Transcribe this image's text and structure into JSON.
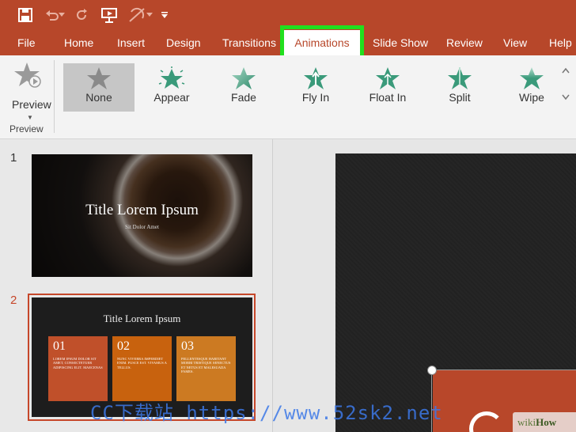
{
  "tabs": [
    {
      "label": "File"
    },
    {
      "label": "Home"
    },
    {
      "label": "Insert"
    },
    {
      "label": "Design"
    },
    {
      "label": "Transitions"
    },
    {
      "label": "Animations"
    },
    {
      "label": "Slide Show"
    },
    {
      "label": "Review"
    },
    {
      "label": "View"
    },
    {
      "label": "Help"
    }
  ],
  "active_tab": "Animations",
  "ribbon": {
    "preview_button": "Preview",
    "preview_group": "Preview",
    "animations": [
      {
        "label": "None",
        "selected": true
      },
      {
        "label": "Appear"
      },
      {
        "label": "Fade"
      },
      {
        "label": "Fly In"
      },
      {
        "label": "Float In"
      },
      {
        "label": "Split"
      },
      {
        "label": "Wipe"
      }
    ]
  },
  "slides": [
    {
      "number": "1",
      "title": "Title Lorem Ipsum",
      "subtitle": "Sit Dolor Amet"
    },
    {
      "number": "2",
      "title": "Title Lorem Ipsum",
      "boxes": [
        {
          "num": "01",
          "text": "LOREM IPSUM DOLOR SIT AMET, CONSECTETUER ADIPISCING ELIT. MAECENAS",
          "color": "#c0502a"
        },
        {
          "num": "02",
          "text": "NUNC VIVERRA IMPERDIET ENIM. FUSCE EST. VIVAMUS A TELLUS.",
          "color": "#c8620e"
        },
        {
          "num": "03",
          "text": "PELLENTESQUE HABITANT MORBI TRISTIQUE SENECTUS ET NETUS ET MALESUADA FAMES.",
          "color": "#cc7a22"
        }
      ]
    }
  ],
  "colors": {
    "ribbon_bar": "#b7472a",
    "highlight": "#21e01e",
    "accent_star": "#3a9a7a"
  },
  "watermarks": {
    "blue": "CC下载站 https://www.52sk2.net",
    "wiki_a": "wiki",
    "wiki_b": "How"
  }
}
